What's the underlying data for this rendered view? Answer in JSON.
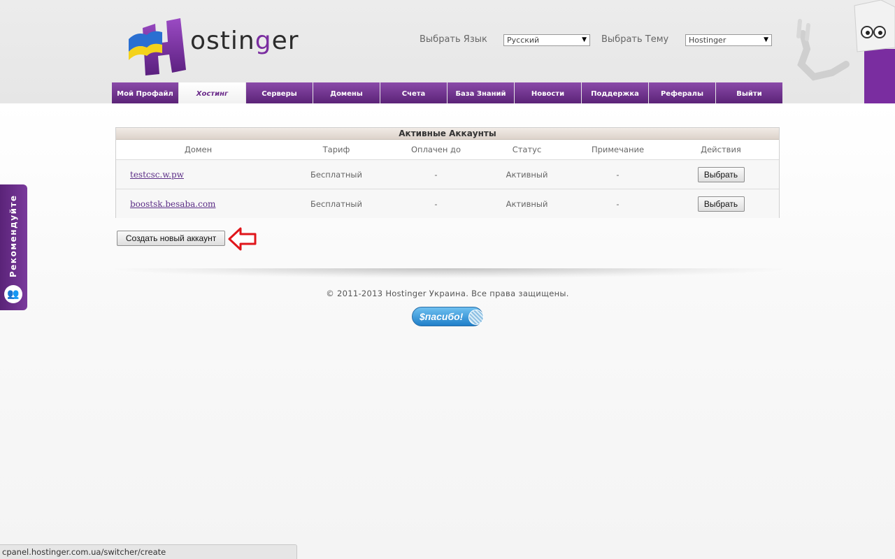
{
  "logo": {
    "text_main": "ostin",
    "text_g": "g",
    "text_end": "er",
    "letter": "H"
  },
  "selectors": {
    "language_label": "Выбрать Язык",
    "language_value": "Русский",
    "theme_label": "Выбрать Тему",
    "theme_value": "Hostinger"
  },
  "nav": {
    "tabs": [
      {
        "label": "Мой Профайл",
        "active": false
      },
      {
        "label": "Хостинг",
        "active": true
      },
      {
        "label": "Серверы",
        "active": false
      },
      {
        "label": "Домены",
        "active": false
      },
      {
        "label": "Счета",
        "active": false
      },
      {
        "label": "База Знаний",
        "active": false
      },
      {
        "label": "Новости",
        "active": false
      },
      {
        "label": "Поддержка",
        "active": false
      },
      {
        "label": "Рефералы",
        "active": false
      },
      {
        "label": "Выйти",
        "active": false
      }
    ]
  },
  "accounts": {
    "title": "Активные Аккаунты",
    "columns": [
      "Домен",
      "Тариф",
      "Оплачен до",
      "Статус",
      "Примечание",
      "Действия"
    ],
    "rows": [
      {
        "domain": "testcsc.w.pw",
        "tariff": "Бесплатный",
        "paid_until": "-",
        "status": "Активный",
        "note": "-",
        "action": "Выбрать"
      },
      {
        "domain": "boostsk.besaba.com",
        "tariff": "Бесплатный",
        "paid_until": "-",
        "status": "Активный",
        "note": "-",
        "action": "Выбрать"
      }
    ]
  },
  "create_button": "Создать новый аккаунт",
  "footer": {
    "copyright": "© 2011-2013 Hostinger Украина. Все права защищены.",
    "spasibo": "$пасибо!"
  },
  "side_tab": {
    "label": "Рекомендуйте"
  },
  "statusbar": {
    "url": "cpanel.hostinger.com.ua/switcher/create"
  },
  "colors": {
    "brand_purple": "#6a2a8a",
    "arrow_red": "#e0161b"
  }
}
